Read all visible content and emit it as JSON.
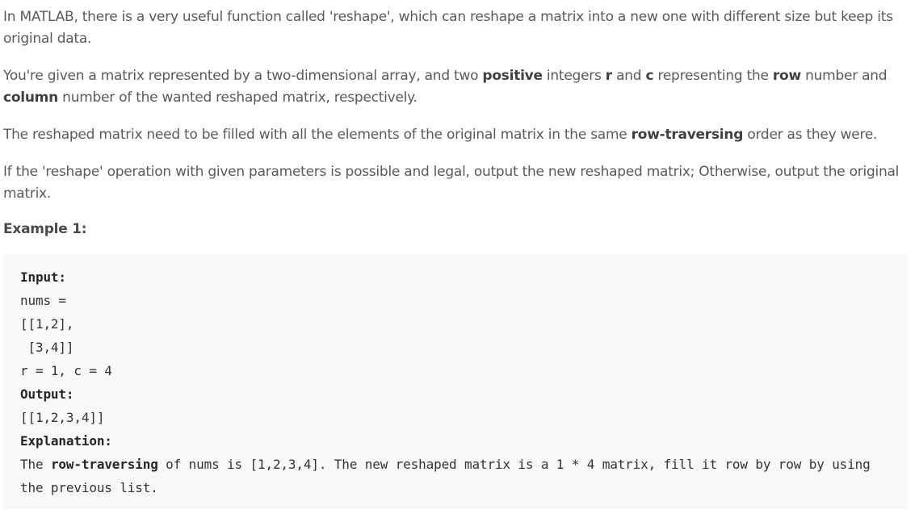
{
  "paragraphs": {
    "p1": "In MATLAB, there is a very useful function called 'reshape', which can reshape a matrix into a new one with different size but keep its original data.",
    "p2": {
      "t1": "You're given a matrix represented by a two-dimensional array, and two ",
      "b1": "positive",
      "t2": " integers ",
      "b2": "r",
      "t3": " and ",
      "b3": "c",
      "t4": " representing the ",
      "b4": "row",
      "t5": " number and ",
      "b5": "column",
      "t6": " number of the wanted reshaped matrix, respectively."
    },
    "p3": {
      "t1": "The reshaped matrix need to be filled with all the elements of the original matrix in the same ",
      "b1": "row-traversing",
      "t2": " order as they were."
    },
    "p4": "If the 'reshape' operation with given parameters is possible and legal, output the new reshaped matrix; Otherwise, output the original matrix."
  },
  "example": {
    "title": "Example 1:",
    "input_label": "Input:",
    "input_line1": "nums =",
    "input_line2": "[[1,2],",
    "input_line3": " [3,4]]",
    "input_line4": "r = 1, c = 4",
    "output_label": "Output:",
    "output_value": "[[1,2,3,4]]",
    "explanation_label": "Explanation:",
    "explanation_t1": "The ",
    "explanation_b1": "row-traversing",
    "explanation_t2": " of nums is [1,2,3,4]. The new reshaped matrix is a 1 * 4 matrix, fill it row by row by using the previous list."
  }
}
